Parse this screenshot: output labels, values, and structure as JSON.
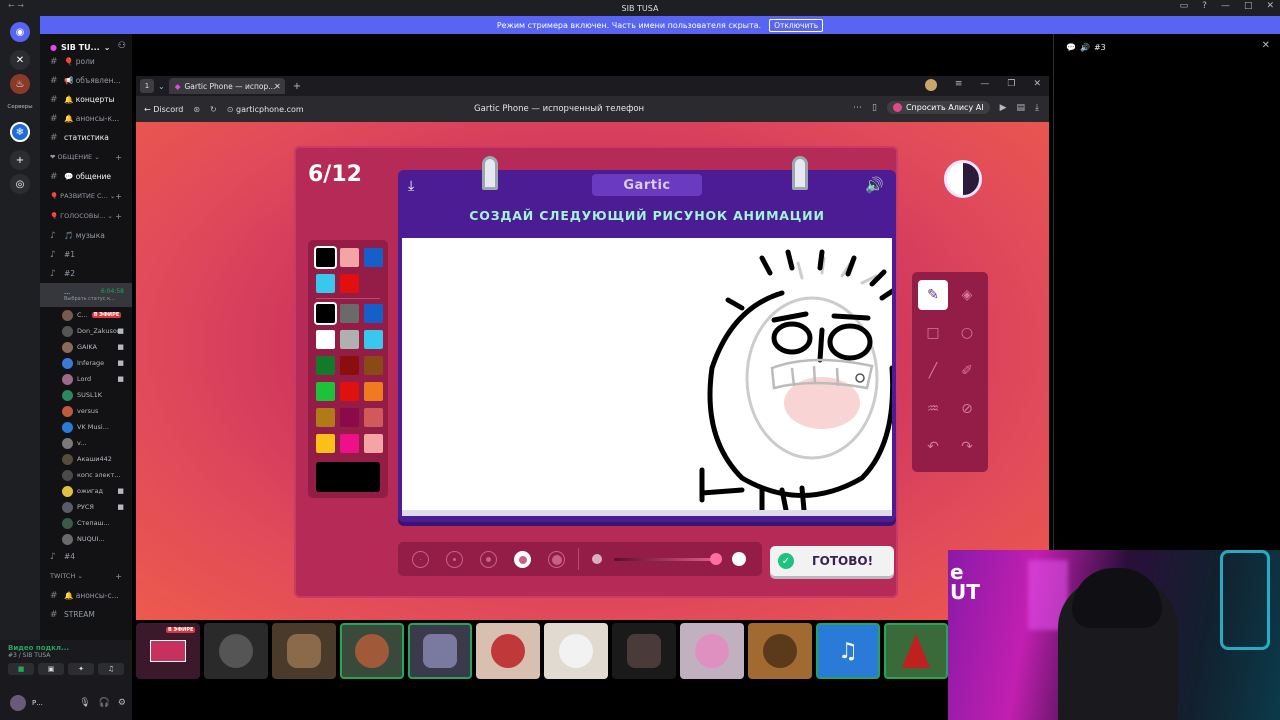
{
  "window": {
    "title": "SIB TUSA"
  },
  "streamer_banner": {
    "text": "Режим стримера включен. Часть имени пользователя скрыта.",
    "button": "Отключить"
  },
  "rail": {
    "servers_label": "Серверы"
  },
  "guild": {
    "name": "SIB TU..."
  },
  "channels": [
    {
      "icon": "#",
      "label": "🎈 роли"
    },
    {
      "icon": "#",
      "label": "📢 объявлен..."
    },
    {
      "icon": "#",
      "label": "🔔 концерты",
      "bright": true
    },
    {
      "icon": "#",
      "label": "🔔 анонсы-к..."
    },
    {
      "icon": "#",
      "label": "статистика",
      "bright": true
    }
  ],
  "cat_general": "❤ ОБЩЕНИЕ",
  "general_channel": "💬 общение",
  "cat_dev": "🎈 РАЗВИТИЕ С...",
  "cat_voice": "🎈 ГОЛОСОВЫ...",
  "voice_channels": [
    {
      "label": "🎵 музыка"
    },
    {
      "label": "#1"
    },
    {
      "label": "#2"
    }
  ],
  "active_voice": {
    "label": "...",
    "timer": "6:04:58",
    "status": "Выбрать статус к..."
  },
  "voice_users": [
    {
      "name": "С...",
      "live": "В ЭФИРЕ",
      "color": "#7a5a4a"
    },
    {
      "name": "Don_Zakuson",
      "color": "#555"
    },
    {
      "name": "GAIKA",
      "color": "#8a6a5a"
    },
    {
      "name": "Inferage",
      "color": "#3a7ad8"
    },
    {
      "name": "Lord",
      "color": "#9a6a8a"
    },
    {
      "name": "SUSL1K",
      "color": "#2a8a5a"
    },
    {
      "name": "versus",
      "color": "#c05a3a"
    },
    {
      "name": "VK Musi...",
      "color": "#2a7ad8"
    },
    {
      "name": "v...",
      "color": "#7a7a7a"
    },
    {
      "name": "Акаши442",
      "color": "#5a4a3a"
    },
    {
      "name": "копс элект...",
      "color": "#4a4a4a"
    },
    {
      "name": "ожигад",
      "color": "#e0c040"
    },
    {
      "name": "РУСЯ",
      "color": "#5a5a6a"
    },
    {
      "name": "Степаш...",
      "color": "#3a5a4a"
    },
    {
      "name": "NUQUI...",
      "color": "#6a6a6a"
    }
  ],
  "voice_channel_4": "#4",
  "cat_twitch": "TWITCH",
  "twitch_channels": [
    {
      "label": "🔔 анонсы-с..."
    },
    {
      "label": "STREAM"
    }
  ],
  "voice_connection": {
    "status": "Видео подкл...",
    "channel": "#3 / SIB TUSA"
  },
  "user_panel": {
    "name": "Р..."
  },
  "right_panel": {
    "title": "#3"
  },
  "browser": {
    "tab_title": "Gartic Phone — испор...",
    "back_label": "Discord",
    "url": "garticphone.com",
    "page_title": "Gartic Phone — испорченный телефон",
    "alice_label": "Спросить Алису AI"
  },
  "game": {
    "round": "6/12",
    "logo": "Gartic",
    "prompt": "СОЗДАЙ СЛЕДУЮЩИЙ РИСУНОК АНИМАЦИИ",
    "done_label": "ГОТОВО!",
    "palette_top": [
      "#000000",
      "#f4a4a4",
      "#1560c8",
      "#38c8ee",
      "#e01010"
    ],
    "palette": [
      "#000000",
      "#6a6a6a",
      "#1560c8",
      "#ffffff",
      "#b0b0b0",
      "#38c8ee",
      "#127a28",
      "#8a0e0e",
      "#8a4a16",
      "#1ec23a",
      "#e01010",
      "#f07a20",
      "#b07a18",
      "#8a0a4a",
      "#d05a5a",
      "#f8c018",
      "#ee1088",
      "#f4a4a4"
    ],
    "selected_color": "#000000",
    "brush_sizes": 5,
    "selected_size": 4,
    "tools": [
      "pen-icon",
      "eraser-icon",
      "rectangle-icon",
      "ellipse-icon",
      "line-icon",
      "eyedropper-icon",
      "fill-icon",
      "clear-icon",
      "undo-icon",
      "redo-icon"
    ],
    "selected_tool": 0
  },
  "strip_badge": "В ЭФИРЕ",
  "webcam_sign": "e\nUT"
}
